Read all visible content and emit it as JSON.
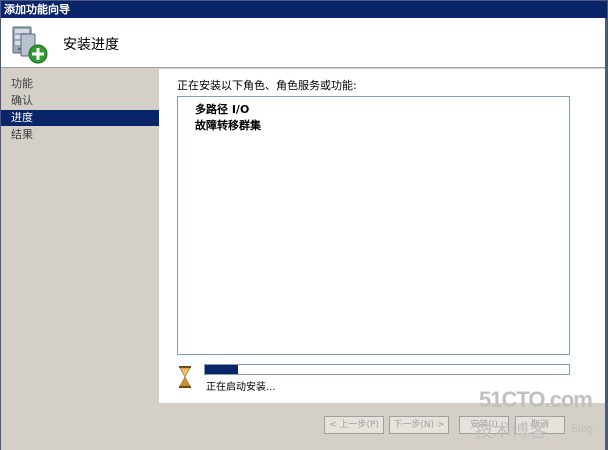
{
  "window": {
    "title": "添加功能向导"
  },
  "header": {
    "title": "安装进度",
    "icon": "server-add-icon"
  },
  "sidebar": {
    "items": [
      {
        "label": "功能",
        "active": false
      },
      {
        "label": "确认",
        "active": false
      },
      {
        "label": "进度",
        "active": true
      },
      {
        "label": "结果",
        "active": false
      }
    ]
  },
  "main": {
    "prompt": "正在安装以下角色、角色服务或功能:",
    "list": [
      {
        "label": "多路径 I/O"
      },
      {
        "label": "故障转移群集"
      }
    ],
    "progress": {
      "fraction": 0.09
    },
    "status": "正在启动安装..."
  },
  "buttons": {
    "prev": "< 上一步(P)",
    "next": "下一步(N) >",
    "install": "安装(I)",
    "cancel": "取消"
  },
  "watermark": {
    "main": "51CTO.com",
    "sub": "技术博客",
    "blog": "Blog"
  },
  "colors": {
    "titlebar": "#0a246a",
    "accent": "#0a246a",
    "face": "#d4d0c8"
  }
}
